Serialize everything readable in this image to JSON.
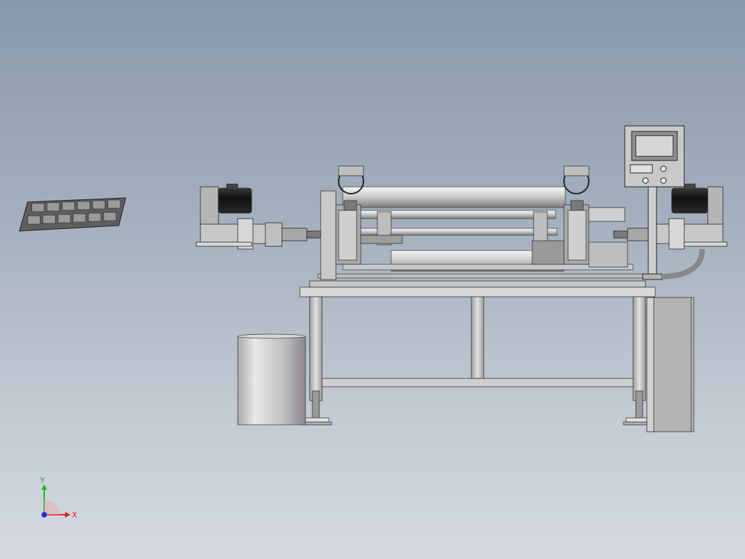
{
  "triad": {
    "y_label": "Y",
    "x_label": "X",
    "y_color": "#1fb41f",
    "x_color": "#e02020",
    "z_color": "#2030d0"
  },
  "model": {
    "metal_light": "#dcdcdc",
    "metal_mid": "#b9b9b9",
    "metal_dark": "#5a5a5a",
    "motor_color": "#1e1e1e",
    "hmi_screen": "#d6d6d6"
  }
}
